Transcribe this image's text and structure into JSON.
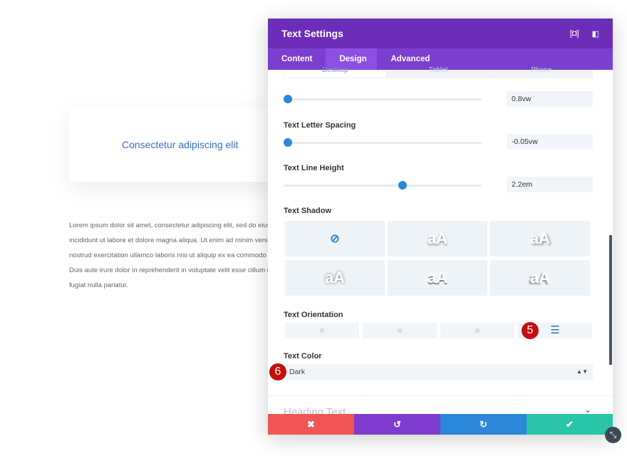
{
  "page": {
    "card_title": "Consectetur adipiscing elit",
    "paragraph_lines": [
      "Lorem ipsum dolor sit amet, consectetur adipiscing elit, sed do eiusmod",
      "incididunt ut labore et dolore magna aliqua. Ut enim ad minim veniam",
      "nostrud exercitation ullamco laboris nisi ut aliquip ex ea commodo co",
      "Duis aute irure dolor in reprehenderit in voluptate velit esse cillum c",
      "fugiat nulla pariatur."
    ]
  },
  "modal": {
    "title": "Text Settings",
    "tabs": [
      "Content",
      "Design",
      "Advanced"
    ],
    "active_tab": "Design",
    "devices": [
      "Desktop",
      "Tablet",
      "Phone"
    ],
    "font_size": {
      "value": "0.8vw",
      "percent": 2
    },
    "letter_spacing": {
      "label": "Text Letter Spacing",
      "value": "-0.05vw",
      "percent": 2
    },
    "line_height": {
      "label": "Text Line Height",
      "value": "2.2em",
      "percent": 60
    },
    "shadow": {
      "label": "Text Shadow",
      "none_icon": "no-shadow-icon",
      "sample": "aA"
    },
    "orientation": {
      "label": "Text Orientation",
      "options": [
        "left",
        "center",
        "right",
        "justify"
      ],
      "selected": "justify"
    },
    "color": {
      "label": "Text Color",
      "value": "Dark"
    },
    "next_section": "Heading Text",
    "badges": [
      "5",
      "6"
    ],
    "footer": {
      "colors": [
        "#ef5555",
        "#7d3bcf",
        "#2b87da",
        "#29c4a9"
      ]
    }
  },
  "colors": {
    "header": "#6c2eb9",
    "tabs": "#7b3fd0",
    "accent": "#2b87da"
  }
}
